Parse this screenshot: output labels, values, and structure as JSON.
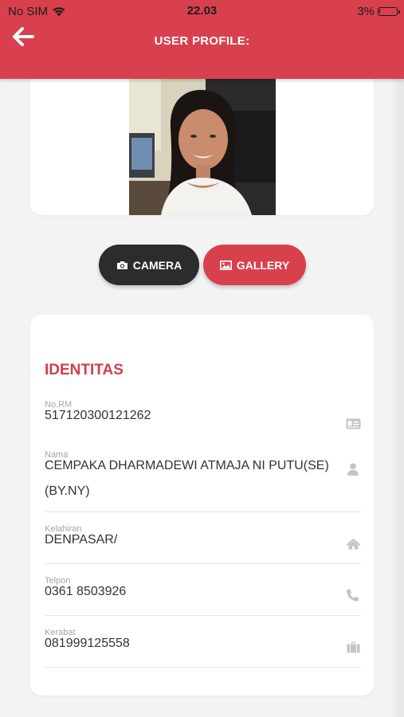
{
  "status_bar": {
    "carrier": "No SIM",
    "time": "22.03",
    "battery_percent": "3%",
    "battery_level": 0.03
  },
  "header": {
    "title": "USER PROFILE:",
    "back_icon": "arrow-left-icon",
    "background_color": "#d8404e"
  },
  "actions": {
    "camera_label": "CAMERA",
    "camera_icon": "camera-icon",
    "gallery_label": "GALLERY",
    "gallery_icon": "image-icon"
  },
  "identity": {
    "section_title": "IDENTITAS",
    "fields": [
      {
        "label": "No.RM",
        "value": "517120300121262",
        "icon": "id-card-icon"
      },
      {
        "label": "Nama",
        "value": "CEMPAKA DHARMADEWI ATMAJA NI PUTU(SE) (BY.NY)",
        "icon": "user-icon"
      },
      {
        "label": "Kelahiran",
        "value": "DENPASAR/",
        "icon": "home-icon"
      },
      {
        "label": "Telpon",
        "value": "0361 8503926",
        "icon": "phone-icon"
      },
      {
        "label": "Kerabat",
        "value": "081999125558",
        "icon": "briefcase-icon"
      }
    ]
  },
  "colors": {
    "accent": "#d8404e",
    "dark_button": "#2b2c2e",
    "background": "#f3f3f3"
  }
}
